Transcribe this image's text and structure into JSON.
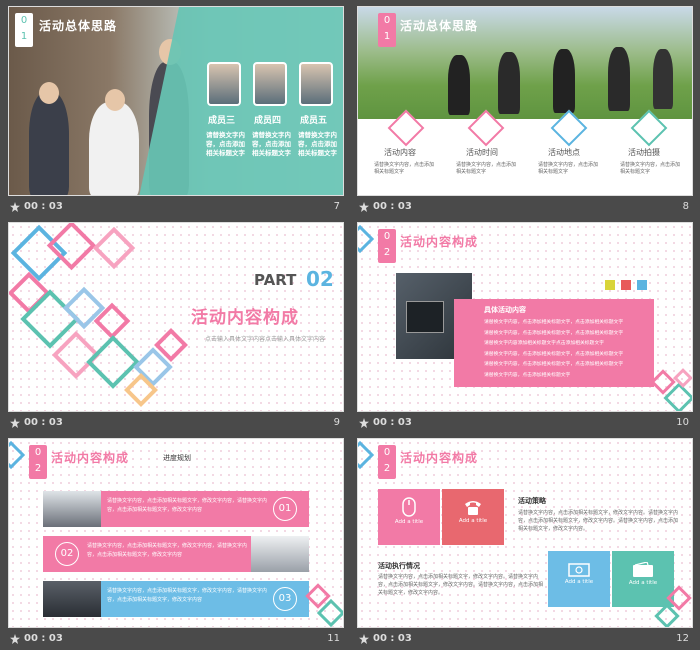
{
  "slides": [
    {
      "number": "7",
      "time": "00 : 03",
      "badge": [
        "0",
        "1"
      ],
      "title": "活动总体思路",
      "members": [
        {
          "name": "成员三",
          "desc": "请替换文字内容，点击添加相关标题文字"
        },
        {
          "name": "成员四",
          "desc": "请替换文字内容，点击添加相关标题文字"
        },
        {
          "name": "成员五",
          "desc": "请替换文字内容，点击添加相关标题文字"
        }
      ]
    },
    {
      "number": "8",
      "time": "00 : 03",
      "badge": [
        "0",
        "1"
      ],
      "title": "活动总体思路",
      "items": [
        {
          "label": "活动内容",
          "desc": "请替换文字内容，点击添加相关标题文字"
        },
        {
          "label": "活动时间",
          "desc": "请替换文字内容，点击添加相关标题文字"
        },
        {
          "label": "活动地点",
          "desc": "请替换文字内容，点击添加相关标题文字"
        },
        {
          "label": "活动拍摄",
          "desc": "请替换文字内容，点击添加相关标题文字"
        }
      ],
      "colors": [
        "#f27aa6",
        "#f27aa6",
        "#5bb4e0",
        "#5cc2b0"
      ]
    },
    {
      "number": "9",
      "time": "00 : 03",
      "part": "PART",
      "part_num": "02",
      "title": "活动内容构成",
      "subtitle": "点击输入具体文字内容点击输入具体文字内容"
    },
    {
      "number": "10",
      "time": "00 : 03",
      "badge": [
        "0",
        "2"
      ],
      "title": "活动内容构成",
      "box_title": "具体活动内容",
      "box_lines": [
        "请替换文字内容，点击添加相关标题文字，点击添加相关标题文字",
        "请替换文字内容，点击添加相关标题文字，点击添加相关标题文字",
        "请替换文字内容添加相关标题文字点击添加相关标题文字",
        "请替换文字内容，点击添加相关标题文字，点击添加相关标题文字",
        "请替换文字内容，点击添加相关标题文字，点击添加相关标题文字",
        "请替换文字内容，点击添加相关标题文字"
      ]
    },
    {
      "number": "11",
      "time": "00 : 03",
      "badge": [
        "0",
        "2"
      ],
      "title": "活动内容构成",
      "subtitle": "进度规划",
      "rows": [
        {
          "num": "01",
          "text": "请替换文字内容，点击添加相关标题文字，修改文字内容，请替换文字内容，点击添加相关标题文字，修改文字内容"
        },
        {
          "num": "02",
          "text": "请替换文字内容，点击添加相关标题文字，修改文字内容，请替换文字内容，点击添加相关标题文字，修改文字内容"
        },
        {
          "num": "03",
          "text": "请替换文字内容，点击添加相关标题文字，修改文字内容，请替换文字内容，点击添加相关标题文字，修改文字内容"
        }
      ]
    },
    {
      "number": "12",
      "time": "00 : 03",
      "badge": [
        "0",
        "2"
      ],
      "title": "活动内容构成",
      "top_heading": "活动策略",
      "bottom_heading": "活动执行情况",
      "strategy_text": "请替换文字内容，点击添加相关标题文字，修改文字内容。请替换文字内容，点击添加相关标题文字，修改文字内容。请替换文字内容，点击添加相关标题文字，修改文字内容。",
      "execution_text": "请替换文字内容，点击添加相关标题文字，修改文字内容。请替换文字内容，点击添加相关标题文字，修改文字内容。请替换文字内容，点击添加相关标题文字，修改文字内容。",
      "tile_label": "Add a title"
    }
  ]
}
